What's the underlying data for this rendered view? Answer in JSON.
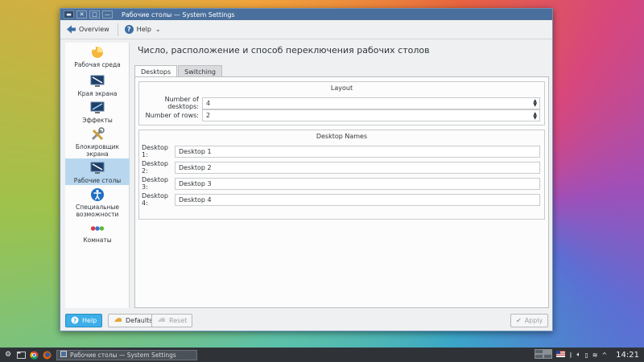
{
  "window": {
    "title": "Рабочие столы — System Settings"
  },
  "toolbar": {
    "overview_label": "Overview",
    "help_label": "Help"
  },
  "sidebar": {
    "items": [
      {
        "label": "Рабочая среда",
        "icon": "workspace-icon"
      },
      {
        "label": "Края экрана",
        "icon": "screen-edges-icon"
      },
      {
        "label": "Эффекты",
        "icon": "effects-icon"
      },
      {
        "label": "Блокировщик экрана",
        "icon": "screen-locker-icon"
      },
      {
        "label": "Рабочие столы",
        "icon": "virtual-desktops-icon"
      },
      {
        "label": "Специальные возможности",
        "icon": "accessibility-icon"
      },
      {
        "label": "Комнаты",
        "icon": "activities-icon"
      }
    ],
    "selected": "Рабочие столы"
  },
  "main": {
    "heading": "Число, расположение и способ переключения рабочих столов",
    "tabs": [
      "Desktops",
      "Switching"
    ],
    "active_tab": "Desktops",
    "layout_group": {
      "title": "Layout",
      "num_desktops_label": "Number of desktops:",
      "num_desktops_value": "4",
      "num_rows_label": "Number of rows:",
      "num_rows_value": "2"
    },
    "names_group": {
      "title": "Desktop Names",
      "rows": [
        {
          "label": "Desktop 1:",
          "value": "Desktop 1"
        },
        {
          "label": "Desktop 2:",
          "value": "Desktop 2"
        },
        {
          "label": "Desktop 3:",
          "value": "Desktop 3"
        },
        {
          "label": "Desktop 4:",
          "value": "Desktop 4"
        }
      ]
    }
  },
  "buttons": {
    "help": "Help",
    "defaults": "Defaults",
    "reset": "Reset",
    "apply": "Apply"
  },
  "taskbar": {
    "task_title": "Рабочие столы — System Settings",
    "clock": "14:21"
  },
  "colors": {
    "accent": "#3daee9",
    "titlebar": "#4a6f9c",
    "selection": "#b8d7ef"
  }
}
